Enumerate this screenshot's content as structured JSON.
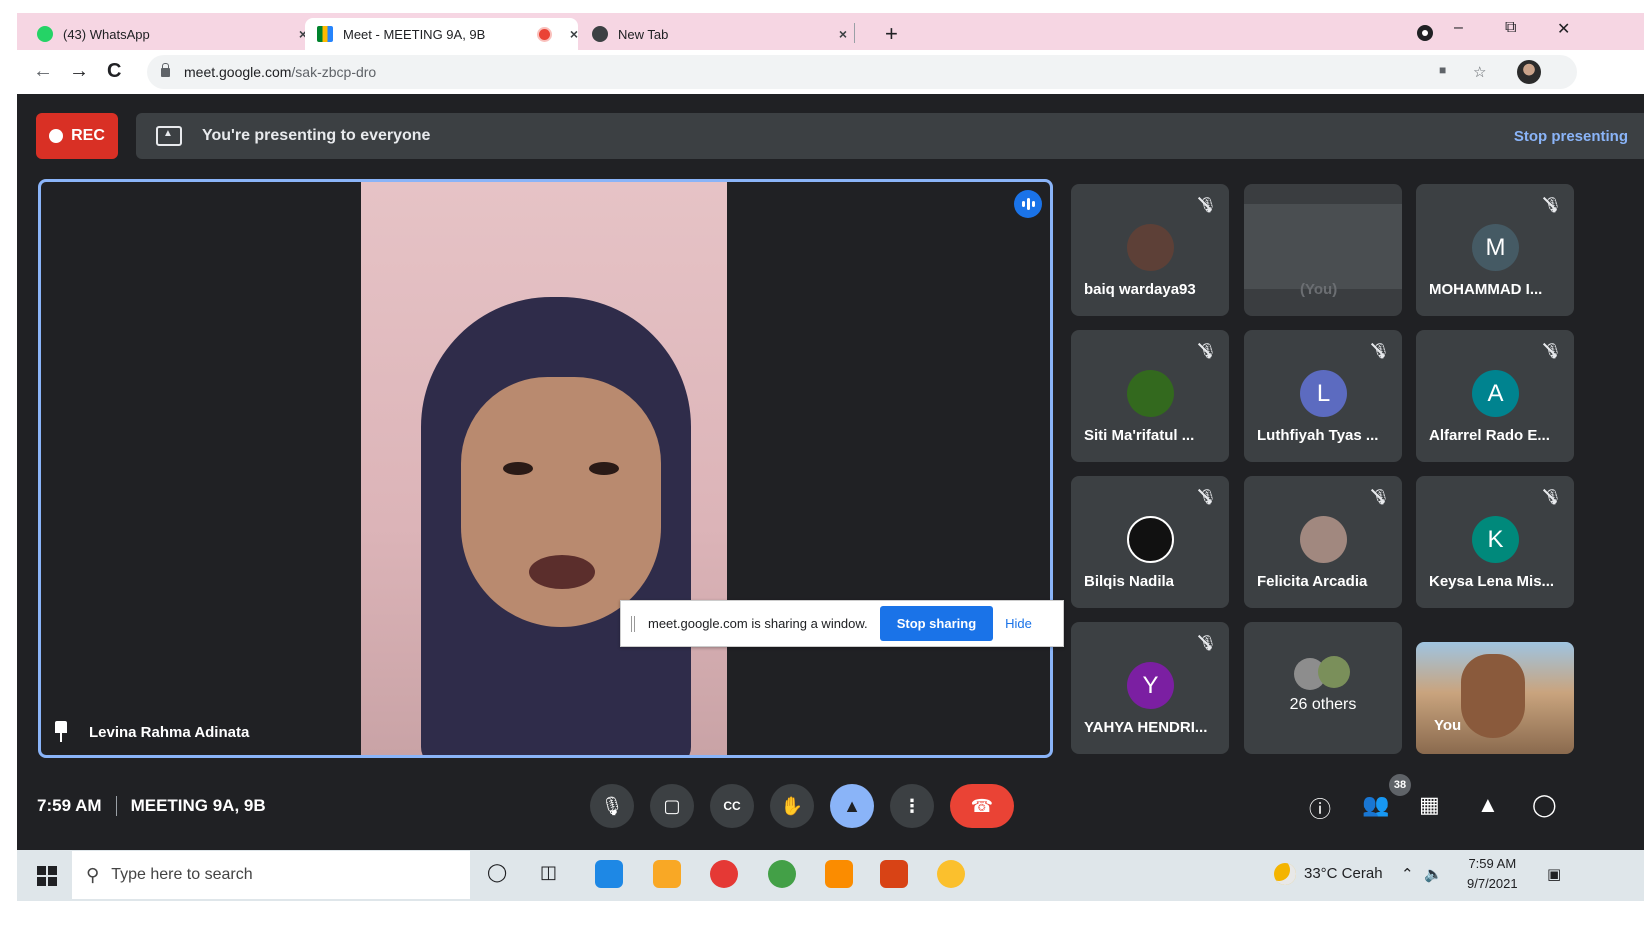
{
  "browser": {
    "tabs": [
      {
        "title": "(43) WhatsApp",
        "close": "×",
        "icon": "whatsapp-icon",
        "color": "#25d366"
      },
      {
        "title": "Meet - MEETING 9A, 9B",
        "close": "×",
        "icon": "google-meet-icon",
        "active": true
      },
      {
        "title": "New Tab",
        "close": "×",
        "icon": "chrome-icon"
      }
    ],
    "new_tab": "+",
    "url_host": "meet.google.com",
    "url_path": "/sak-zbcp-dro"
  },
  "meet": {
    "rec_label": "REC",
    "presenting_text": "You're presenting to everyone",
    "stop_presenting_label": "Stop presenting",
    "main_speaker": "Levina Rahma Adinata",
    "share_notice": {
      "text": "meet.google.com is sharing a window.",
      "stop_label": "Stop sharing",
      "hide_label": "Hide"
    },
    "participants": [
      {
        "name": "baiq wardaya93",
        "avatar": "photo",
        "color": "#5d4037"
      },
      {
        "name": "(You)",
        "avatar": "screen"
      },
      {
        "name": "MOHAMMAD I...",
        "initial": "M",
        "color": "#455a64"
      },
      {
        "name": "Siti Ma'rifatul ...",
        "avatar": "photo",
        "color": "#33691e"
      },
      {
        "name": "Luthfiyah Tyas ...",
        "initial": "L",
        "color": "#5c6bc0"
      },
      {
        "name": "Alfarrel Rado E...",
        "initial": "A",
        "color": "#00838f"
      },
      {
        "name": "Bilqis Nadila",
        "avatar": "photo",
        "color": "#111111"
      },
      {
        "name": "Felicita Arcadia",
        "avatar": "photo",
        "color": "#a1887f"
      },
      {
        "name": "Keysa Lena Mis...",
        "initial": "K",
        "color": "#00897b"
      },
      {
        "name": "YAHYA HENDRI...",
        "initial": "Y",
        "color": "#7b1fa2"
      },
      {
        "others": "26 others"
      },
      {
        "name": "You",
        "avatar": "self-video"
      }
    ],
    "time": "7:59 AM",
    "meeting_name": "MEETING 9A, 9B",
    "people_count": "38"
  },
  "taskbar": {
    "search_placeholder": "Type here to search",
    "weather": "33°C  Cerah",
    "clock_time": "7:59 AM",
    "clock_date": "9/7/2021"
  }
}
